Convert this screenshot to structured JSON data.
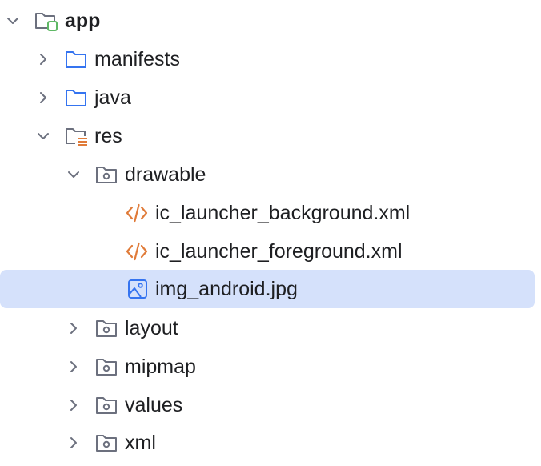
{
  "tree": {
    "items": [
      {
        "label": "app",
        "depth": 0,
        "expanded": true,
        "icon": "module-folder-icon"
      },
      {
        "label": "manifests",
        "depth": 1,
        "expanded": false,
        "icon": "folder-icon"
      },
      {
        "label": "java",
        "depth": 1,
        "expanded": false,
        "icon": "folder-icon"
      },
      {
        "label": "res",
        "depth": 1,
        "expanded": true,
        "icon": "resources-folder-icon"
      },
      {
        "label": "drawable",
        "depth": 2,
        "expanded": true,
        "icon": "package-folder-icon"
      },
      {
        "label": "ic_launcher_background.xml",
        "depth": 3,
        "icon": "xml-file-icon"
      },
      {
        "label": "ic_launcher_foreground.xml",
        "depth": 3,
        "icon": "xml-file-icon"
      },
      {
        "label": "img_android.jpg",
        "depth": 3,
        "icon": "image-file-icon",
        "selected": true
      },
      {
        "label": "layout",
        "depth": 2,
        "expanded": false,
        "icon": "package-folder-icon"
      },
      {
        "label": "mipmap",
        "depth": 2,
        "expanded": false,
        "icon": "package-folder-icon"
      },
      {
        "label": "values",
        "depth": 2,
        "expanded": false,
        "icon": "package-folder-icon"
      },
      {
        "label": "xml",
        "depth": 2,
        "expanded": false,
        "icon": "package-folder-icon"
      }
    ]
  },
  "colors": {
    "selection": "#d5e1fb",
    "folder_blue": "#3574f0",
    "folder_gray": "#6c707e",
    "xml_orange": "#e07b39",
    "module_green": "#5fb865",
    "text": "#1e1f22"
  }
}
